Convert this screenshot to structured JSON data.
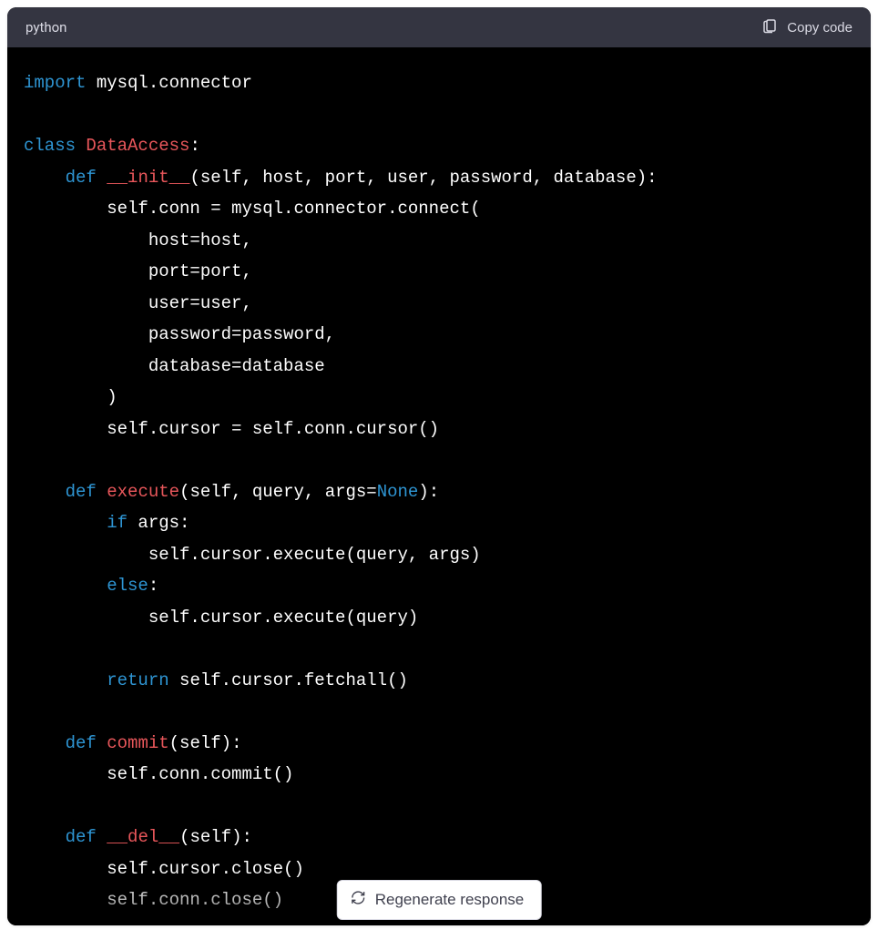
{
  "header": {
    "language": "python",
    "copy_label": "Copy code"
  },
  "code": {
    "lines": [
      [
        {
          "t": "kw",
          "v": "import"
        },
        {
          "t": "plain",
          "v": " mysql.connector"
        }
      ],
      [
        {
          "t": "plain",
          "v": ""
        }
      ],
      [
        {
          "t": "kw",
          "v": "class"
        },
        {
          "t": "plain",
          "v": " "
        },
        {
          "t": "cls",
          "v": "DataAccess"
        },
        {
          "t": "plain",
          "v": ":"
        }
      ],
      [
        {
          "t": "plain",
          "v": "    "
        },
        {
          "t": "kw",
          "v": "def"
        },
        {
          "t": "plain",
          "v": " "
        },
        {
          "t": "cls",
          "v": "__init__"
        },
        {
          "t": "plain",
          "v": "(self, host, port, user, password, database):"
        }
      ],
      [
        {
          "t": "plain",
          "v": "        self.conn = mysql.connector.connect("
        }
      ],
      [
        {
          "t": "plain",
          "v": "            host=host,"
        }
      ],
      [
        {
          "t": "plain",
          "v": "            port=port,"
        }
      ],
      [
        {
          "t": "plain",
          "v": "            user=user,"
        }
      ],
      [
        {
          "t": "plain",
          "v": "            password=password,"
        }
      ],
      [
        {
          "t": "plain",
          "v": "            database=database"
        }
      ],
      [
        {
          "t": "plain",
          "v": "        )"
        }
      ],
      [
        {
          "t": "plain",
          "v": "        self.cursor = self.conn.cursor()"
        }
      ],
      [
        {
          "t": "plain",
          "v": ""
        }
      ],
      [
        {
          "t": "plain",
          "v": "    "
        },
        {
          "t": "kw",
          "v": "def"
        },
        {
          "t": "plain",
          "v": " "
        },
        {
          "t": "cls",
          "v": "execute"
        },
        {
          "t": "plain",
          "v": "(self, query, args="
        },
        {
          "t": "none",
          "v": "None"
        },
        {
          "t": "plain",
          "v": "):"
        }
      ],
      [
        {
          "t": "plain",
          "v": "        "
        },
        {
          "t": "kw",
          "v": "if"
        },
        {
          "t": "plain",
          "v": " args:"
        }
      ],
      [
        {
          "t": "plain",
          "v": "            self.cursor.execute(query, args)"
        }
      ],
      [
        {
          "t": "plain",
          "v": "        "
        },
        {
          "t": "kw",
          "v": "else"
        },
        {
          "t": "plain",
          "v": ":"
        }
      ],
      [
        {
          "t": "plain",
          "v": "            self.cursor.execute(query)"
        }
      ],
      [
        {
          "t": "plain",
          "v": ""
        }
      ],
      [
        {
          "t": "plain",
          "v": "        "
        },
        {
          "t": "kw",
          "v": "return"
        },
        {
          "t": "plain",
          "v": " self.cursor.fetchall()"
        }
      ],
      [
        {
          "t": "plain",
          "v": ""
        }
      ],
      [
        {
          "t": "plain",
          "v": "    "
        },
        {
          "t": "kw",
          "v": "def"
        },
        {
          "t": "plain",
          "v": " "
        },
        {
          "t": "cls",
          "v": "commit"
        },
        {
          "t": "plain",
          "v": "(self):"
        }
      ],
      [
        {
          "t": "plain",
          "v": "        self.conn.commit()"
        }
      ],
      [
        {
          "t": "plain",
          "v": ""
        }
      ],
      [
        {
          "t": "plain",
          "v": "    "
        },
        {
          "t": "kw",
          "v": "def"
        },
        {
          "t": "plain",
          "v": " "
        },
        {
          "t": "cls",
          "v": "__del__"
        },
        {
          "t": "plain",
          "v": "(self):"
        }
      ],
      [
        {
          "t": "plain",
          "v": "        self.cursor.close()"
        }
      ],
      [
        {
          "t": "plain",
          "v": "        self.conn.close()"
        }
      ]
    ]
  },
  "regen": {
    "label": "Regenerate response"
  }
}
